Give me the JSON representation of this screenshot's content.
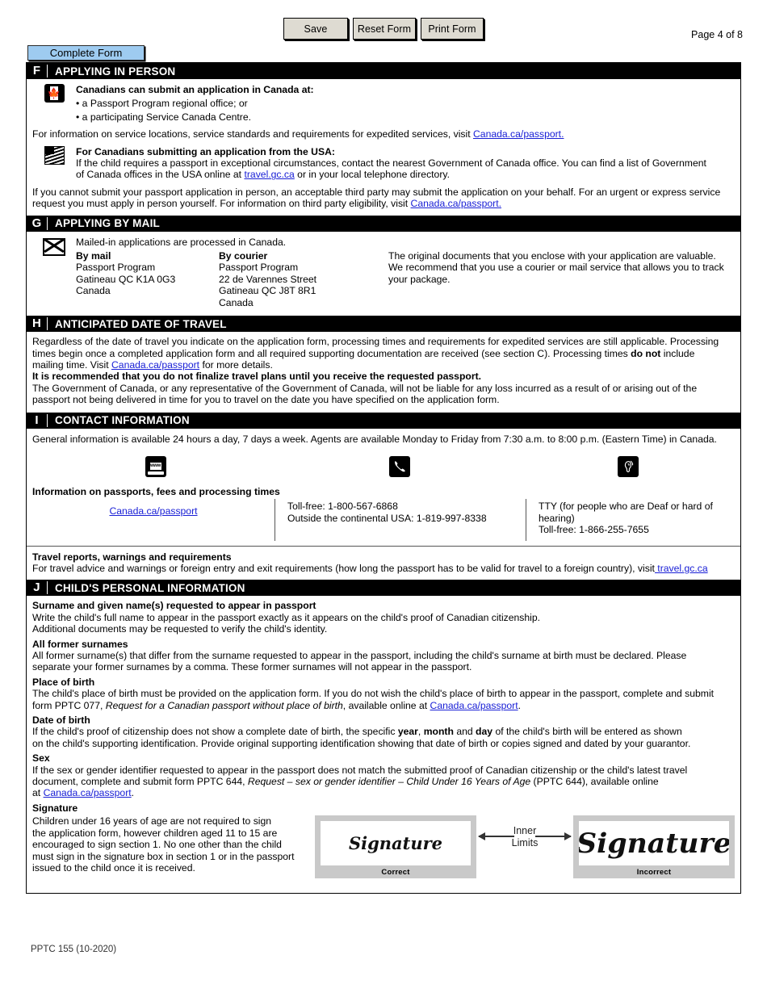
{
  "toolbar": {
    "save_label": "Save",
    "reset_label": "Reset Form",
    "print_label": "Print Form",
    "page_label": "Page 4 of 8",
    "complete_form_label": "Complete Form"
  },
  "colors": {
    "accent_button": "#9ecbf0",
    "toolbar_button": "#dedbd2",
    "link": "#1a20d6",
    "section_header_bg": "#000000"
  },
  "sections": {
    "f": {
      "letter": "F",
      "title": "APPLYING IN PERSON",
      "canada_heading": "Canadians can submit an application in Canada at:",
      "canada_bullet_1": "• a Passport Program regional office; or",
      "canada_bullet_2": "• a participating Service Canada Centre.",
      "service_locations_pre": "For information on service locations, service standards and requirements for expedited services, visit ",
      "service_locations_link": "Canada.ca/passport.",
      "usa_heading": "For Canadians submitting an application from the USA:",
      "usa_text_1": "If the child requires a passport in exceptional circumstances, contact the nearest Government of Canada office. You can find a list of Government",
      "usa_text_2_pre": "of Canada offices in the USA online at ",
      "usa_text_2_link": "travel.gc.ca",
      "usa_text_2_post": " or in your local telephone directory.",
      "third_party_1": "If you cannot submit your passport application in person, an acceptable third party may submit the application on your behalf. For an urgent or express service",
      "third_party_2_pre": "request you must apply in person yourself. For information on third party eligibility, visit ",
      "third_party_2_link": "Canada.ca/passport."
    },
    "g": {
      "letter": "G",
      "title": "APPLYING BY MAIL",
      "intro": "Mailed-in applications are processed in Canada.",
      "by_mail_heading": "By mail",
      "by_mail_lines": [
        "Passport Program",
        "Gatineau QC K1A 0G3",
        "Canada"
      ],
      "by_courier_heading": "By courier",
      "by_courier_lines": [
        "Passport Program",
        "22 de Varennes Street",
        "Gatineau QC J8T 8R1",
        "Canada"
      ],
      "note_lines": [
        "The original documents that you enclose with your application are valuable.",
        "We recommend that you use a courier or mail service that allows you to track",
        "your package."
      ]
    },
    "h": {
      "letter": "H",
      "title": "ANTICIPATED DATE OF TRAVEL",
      "p1_a": "Regardless of the date of travel you indicate on the application form, processing times and requirements for expedited services are still applicable. Processing",
      "p1_b": "times begin once a completed application form and all required supporting documentation are received (see section C). Processing times ",
      "p1_bold": "do not",
      "p1_c": " include",
      "p1_d": "mailing time. Visit ",
      "p1_link": "Canada.ca/passport",
      "p1_e": " for more details.",
      "recommend_bold_1": "It is recommended that you ",
      "recommend_bold_2": "do not",
      "recommend_bold_3": " finalize travel plans until you ",
      "recommend_bold_4": "receive the requested passport.",
      "p2_a": "The Government of Canada, or any representative of the Government of Canada, will not be liable for any loss incurred as a result of or arising out of the",
      "p2_b": "passport not being delivered in time for you to travel on the date you have specified on the application form."
    },
    "i": {
      "letter": "I",
      "title": "CONTACT INFORMATION",
      "hours": "General information is available 24 hours a day, 7 days a week. Agents are available Monday to Friday from 7:30 a.m. to 8:00 p.m. (Eastern Time) in Canada.",
      "icons": {
        "web": "www-monitor-icon",
        "phone": "telephone-handset-icon",
        "tty": "ear-hearing-icon",
        "web_label": "www"
      },
      "info_heading": "Information on passports, fees and processing times",
      "web_link": "Canada.ca/passport",
      "phone_line_1": "Toll-free: 1-800-567-6868",
      "phone_line_2": "Outside the continental USA: 1-819-997-8338",
      "tty_line_1": "TTY (for people who are Deaf or hard of hearing)",
      "tty_line_2": "Toll-free: 1-866-255-7655",
      "travel_heading": "Travel reports, warnings and requirements",
      "travel_text": "For travel advice and warnings or foreign entry and exit requirements (how long the passport has to be valid for travel to a foreign country), visit",
      "travel_link": " travel.gc.ca"
    },
    "j": {
      "letter": "J",
      "title": "CHILD'S PERSONAL INFORMATION",
      "surname_heading": "Surname and given name(s) requested to appear in passport",
      "surname_line_1": "Write the child's full name to appear in the passport exactly as it appears on the child's proof of Canadian citizenship.",
      "surname_line_2": "Additional documents may be requested to verify the child's identity.",
      "former_heading": "All former surnames",
      "former_line_1": "All former surname(s) that differ from the surname requested to appear in the passport, including the child's surname at birth must be declared. Please",
      "former_line_2": "separate your former surnames by a comma. These former surnames will not appear in the passport.",
      "place_heading": "Place of birth",
      "place_line_1": "The child's place of birth must be provided on the application form. If you do not wish the child's place of birth to appear in the passport, complete and submit",
      "place_line_2_a": "form PPTC 077, ",
      "place_line_2_italic": "Request for a Canadian passport without place of birth",
      "place_line_2_b": ", available online at ",
      "place_line_2_link": "Canada.ca/passport",
      "place_line_2_c": ".",
      "dob_heading": "Date of birth",
      "dob_line_1_a": "If the child's proof of citizenship does not show a complete date of birth, the specific ",
      "dob_bold_1": "year",
      "dob_line_1_b": ", ",
      "dob_bold_2": "month",
      "dob_line_1_c": " and ",
      "dob_bold_3": "day",
      "dob_line_1_d": " of the child's birth will be entered as shown",
      "dob_line_2": "on the child's supporting identification. Provide original supporting identification showing that date of birth or copies signed and dated by your guarantor.",
      "sex_heading": "Sex",
      "sex_line_1": "If the sex or gender identifier requested to appear in the passport does not match the submitted proof of Canadian citizenship or the child's latest travel",
      "sex_line_2_a": "document, complete and submit form PPTC 644,  ",
      "sex_line_2_italic": "Request – sex or gender identifier – Child Under 16 Years of Age",
      "sex_line_2_b": " (PPTC 644), available online",
      "sex_line_3_a": "at ",
      "sex_line_3_link": "Canada.ca/passport",
      "sex_line_3_b": ".",
      "signature_heading": "Signature",
      "signature_lines": [
        "Children under 16 years of age are not required to sign",
        "the application form, however children aged 11 to 15 are",
        "encouraged to sign section 1. No one other than the child",
        "must sign in the signature box in section 1 or in the passport",
        "issued to the child once it is received."
      ],
      "signature_graphic": {
        "correct_word": "Signature",
        "correct_caption": "Correct",
        "incorrect_word": "Signature",
        "incorrect_caption": "Incorrect",
        "inner_limits_line_1": "Inner",
        "inner_limits_line_2": "Limits"
      }
    }
  },
  "footer": {
    "form_code": "PPTC 155 (10-2020)"
  }
}
